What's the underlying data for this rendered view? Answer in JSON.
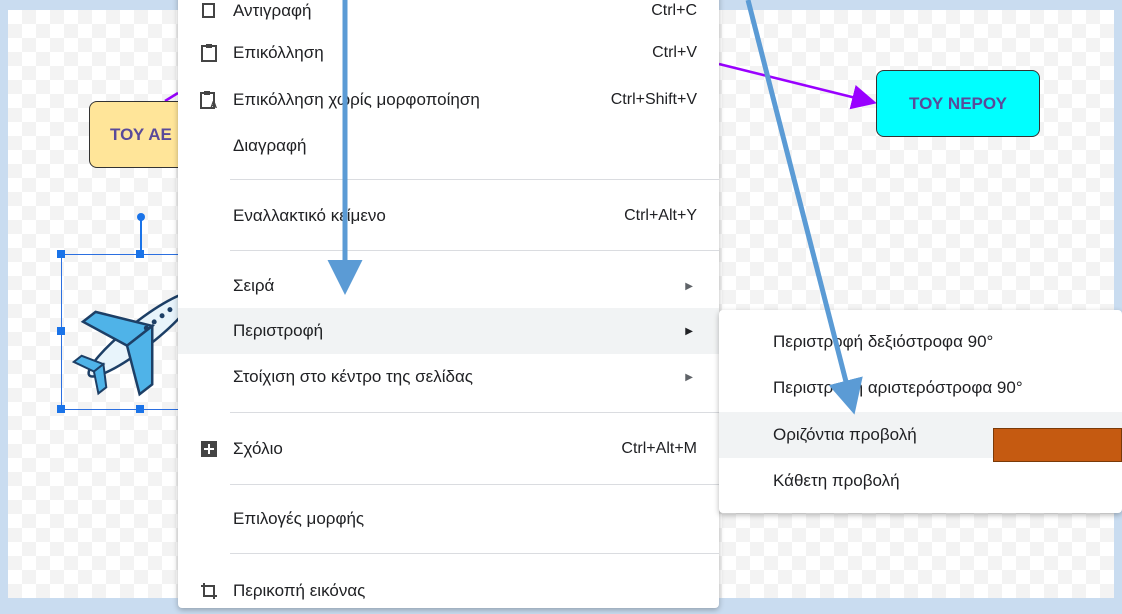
{
  "canvas": {
    "box_air_label": "ΤΟΥ ΑΕ",
    "box_water_label": "ΤΟΥ ΝΕΡΟΥ"
  },
  "colors": {
    "box_air": "#ffe599",
    "box_water": "#00ffff",
    "connector": "#9900ff",
    "annotation_arrow": "#5b9bd5",
    "orange_rect": "#c55a11",
    "selection": "#1a73e8"
  },
  "context_menu": {
    "items": [
      {
        "label": "Αντιγραφή",
        "shortcut": "Ctrl+C",
        "icon": "copy-icon"
      },
      {
        "label": "Επικόλληση",
        "shortcut": "Ctrl+V",
        "icon": "paste-icon"
      },
      {
        "label": "Επικόλληση χωρίς μορφοποίηση",
        "shortcut": "Ctrl+Shift+V",
        "icon": "paste-plain-icon"
      },
      {
        "label": "Διαγραφή",
        "shortcut": ""
      },
      {
        "label": "Εναλλακτικό κείμενο",
        "shortcut": "Ctrl+Alt+Y"
      },
      {
        "label": "Σειρά",
        "submenu": true
      },
      {
        "label": "Περιστροφή",
        "submenu": true,
        "highlighted": true
      },
      {
        "label": "Στοίχιση στο κέντρο της σελίδας",
        "submenu": true
      },
      {
        "label": "Σχόλιο",
        "shortcut": "Ctrl+Alt+M",
        "icon": "add-comment-icon"
      },
      {
        "label": "Επιλογές μορφής"
      },
      {
        "label": "Περικοπή εικόνας",
        "icon": "crop-icon"
      }
    ]
  },
  "rotate_submenu": {
    "items": [
      {
        "label": "Περιστροφή δεξιόστροφα 90°"
      },
      {
        "label": "Περιστροφή αριστερόστροφα 90°"
      },
      {
        "label": "Οριζόντια προβολή",
        "highlighted": true
      },
      {
        "label": "Κάθετη προβολή"
      }
    ]
  }
}
